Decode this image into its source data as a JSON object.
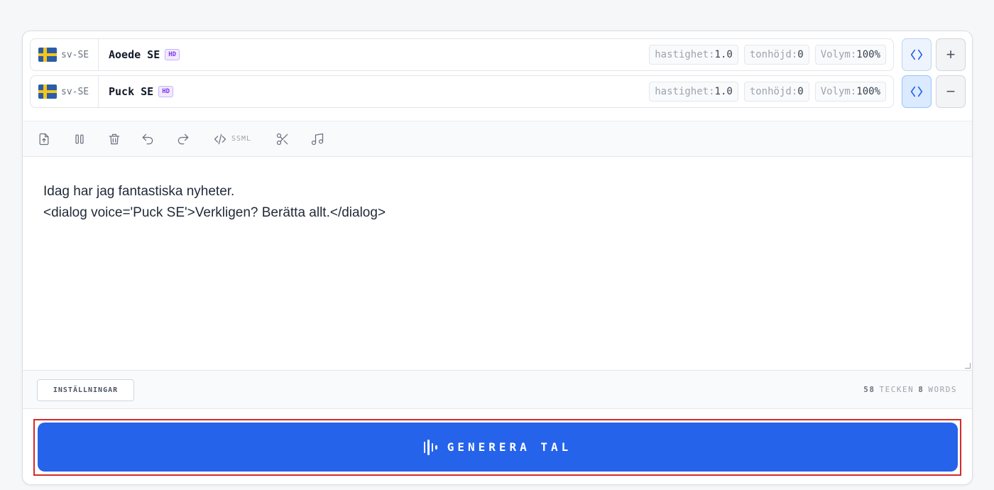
{
  "voices": [
    {
      "lang": "sv-SE",
      "name": "Aoede SE",
      "badge": "HD",
      "params": [
        {
          "label": "hastighet:",
          "value": "1.0"
        },
        {
          "label": "tonhöjd:",
          "value": "0"
        },
        {
          "label": "Volym:",
          "value": "100%"
        }
      ],
      "action_symbol": "+"
    },
    {
      "lang": "sv-SE",
      "name": "Puck SE",
      "badge": "HD",
      "params": [
        {
          "label": "hastighet:",
          "value": "1.0"
        },
        {
          "label": "tonhöjd:",
          "value": "0"
        },
        {
          "label": "Volym:",
          "value": "100%"
        }
      ],
      "action_symbol": "−"
    }
  ],
  "toolbar": {
    "ssml_label": "SSML"
  },
  "editor": {
    "lines": [
      "Idag har jag fantastiska nyheter.",
      "<dialog voice='Puck SE'>Verkligen? Berätta allt.</dialog>"
    ]
  },
  "footer": {
    "settings_label": "INSTÄLLNINGAR",
    "char_count": "58",
    "char_label": "TECKEN",
    "word_count": "8",
    "word_label": "WORDS"
  },
  "generate": {
    "label": "GENERERA TAL"
  },
  "colors": {
    "accent": "#2563eb",
    "highlight_border": "#d42a2a"
  }
}
